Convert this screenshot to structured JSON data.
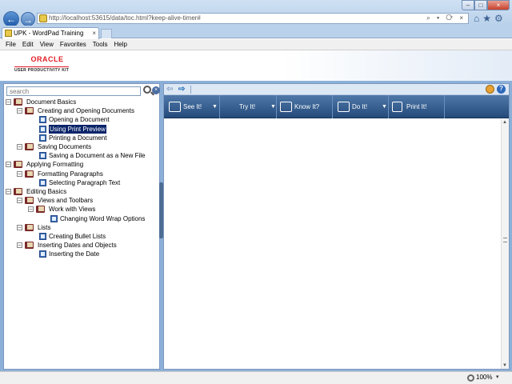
{
  "browser": {
    "address": "http://localhost:53615/data/toc.html?keep-alive-timer#",
    "tab_title": "UPK - WordPad Training",
    "tab_close": "×",
    "address_tools": "⌕ ▾ ⟳ ×",
    "toolbar_icons": "⌂★⚙",
    "back_glyph": "←",
    "forward_glyph": "→"
  },
  "window_controls": {
    "minimize": "–",
    "maximize": "□",
    "close": "×"
  },
  "menu": [
    "File",
    "Edit",
    "View",
    "Favorites",
    "Tools",
    "Help"
  ],
  "header": {
    "logo": "ORACLE",
    "product": "USER PRODUCTIVITY KIT"
  },
  "search": {
    "placeholder": "search",
    "clear": "×"
  },
  "toc": [
    {
      "label": "Document Basics",
      "level": 0,
      "type": "book",
      "expander": "–"
    },
    {
      "label": "Creating and Opening Documents",
      "level": 1,
      "type": "book",
      "expander": "–"
    },
    {
      "label": "Opening a Document",
      "level": 2,
      "type": "topic"
    },
    {
      "label": "Using Print Preview",
      "level": 2,
      "type": "topic",
      "selected": true
    },
    {
      "label": "Printing a Document",
      "level": 2,
      "type": "topic"
    },
    {
      "label": "Saving Documents",
      "level": 1,
      "type": "book",
      "expander": "–"
    },
    {
      "label": "Saving a Document as a New File",
      "level": 2,
      "type": "topic"
    },
    {
      "label": "Applying Formatting",
      "level": 0,
      "type": "book",
      "expander": "–"
    },
    {
      "label": "Formatting Paragraphs",
      "level": 1,
      "type": "book",
      "expander": "–"
    },
    {
      "label": "Selecting Paragraph Text",
      "level": 2,
      "type": "topic"
    },
    {
      "label": "Editing Basics",
      "level": 0,
      "type": "book",
      "expander": "–"
    },
    {
      "label": "Views and Toolbars",
      "level": 1,
      "type": "book",
      "expander": "–"
    },
    {
      "label": "Work with Views",
      "level": 2,
      "type": "book",
      "expander": "–"
    },
    {
      "label": "Changing Word Wrap Options",
      "level": 3,
      "type": "topic"
    },
    {
      "label": "Lists",
      "level": 1,
      "type": "book",
      "expander": "–"
    },
    {
      "label": "Creating Bullet Lists",
      "level": 2,
      "type": "topic"
    },
    {
      "label": "Inserting Dates and Objects",
      "level": 1,
      "type": "book",
      "expander": "–"
    },
    {
      "label": "Inserting the Date",
      "level": 2,
      "type": "topic"
    }
  ],
  "modes": [
    {
      "label": "See It!",
      "icon": "play-icon",
      "dropdown": true
    },
    {
      "label": "Try It!",
      "icon": "hand-icon",
      "dropdown": true
    },
    {
      "label": "Know It?",
      "icon": "check-icon",
      "dropdown": false
    },
    {
      "label": "Do It!",
      "icon": "window-icon",
      "dropdown": true
    },
    {
      "label": "Print It!",
      "icon": "print-icon",
      "dropdown": false
    }
  ],
  "content_nav": {
    "back": "⇦",
    "forward": "⇨",
    "help": "?"
  },
  "mode_dropdown_glyph": "▼",
  "scrollbar": {
    "up": "▲",
    "down": "▼"
  },
  "status": {
    "zoom": "100%",
    "zoom_dropdown": "▾"
  },
  "colors": {
    "selection": "#0a246a",
    "mode_bar": "#244a7a",
    "oracle_red": "#e21d25"
  }
}
